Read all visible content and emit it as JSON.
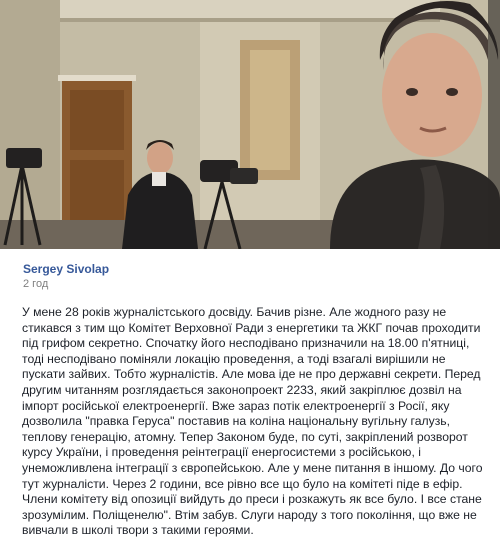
{
  "post": {
    "author": "Sergey Sivolap",
    "time": "2 год",
    "body": "У мене 28 років журналістського досвіду. Бачив різне. Але жодного разу не стикався з тим що Комітет Верховної Ради з енергетики та ЖКГ почав проходити під грифом секретно. Спочатку його несподівано призначили на 18.00 п'ятниці, тоді несподівано поміняли локацію проведення, а тоді взагалі вирішили не пускати зайвих. Тобто журналістів. Але мова іде не про державні секрети. Перед другим читанням розглядається законопроект 2233, який закріплює дозвіл на імпорт російської електроенергії. Вже зараз потік електроенергії з Росії, яку дозволила \"правка Геруса\" поставив на коліна національну вугільну галузь, теплову генерацію, атомну. Тепер Законом буде, по суті, закріплений розворот курсу України, і проведення реінтеграції енергосистеми з російською, і унеможливлена інтеграції з європейською. Але у мене питання в іншому. До чого тут журналісти. Через 2 години, все рівно все що було на комітеті піде в ефір. Члени комітету від опозиції вийдуть до преси і розкажуть як все було. І все стане зрозумілим. Поліщенелю\". Втім забув. Слуги народу з того покоління, що вже не вивчали в школі твори з такими героями."
  },
  "photo": {
    "watermark": "Depositphotos",
    "colors": {
      "wall": "#c9c1ab",
      "door": "#8a5a2e",
      "jacket": "#2f2c2a",
      "skin": "#d8a98e"
    }
  }
}
